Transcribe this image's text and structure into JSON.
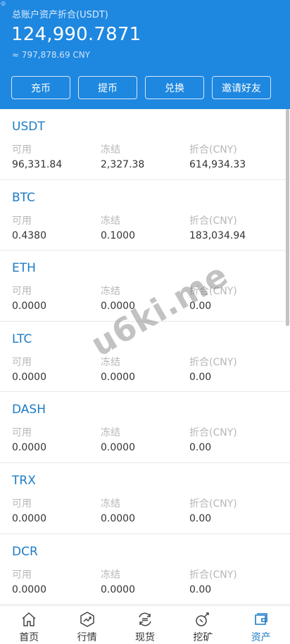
{
  "header": {
    "total_label": "总账户资产折合(USDT)",
    "total_value": "124,990.7871",
    "cny_value": "≈ 797,878.69 CNY",
    "buttons": [
      "充币",
      "提币",
      "兑换",
      "邀请好友"
    ]
  },
  "columns": [
    "可用",
    "冻结",
    "折合(CNY)"
  ],
  "coins": [
    {
      "name": "USDT",
      "available": "96,331.84",
      "frozen": "2,327.38",
      "cny": "614,934.33"
    },
    {
      "name": "BTC",
      "available": "0.4380",
      "frozen": "0.1000",
      "cny": "183,034.94"
    },
    {
      "name": "ETH",
      "available": "0.0000",
      "frozen": "0.0000",
      "cny": "0.00"
    },
    {
      "name": "LTC",
      "available": "0.0000",
      "frozen": "0.0000",
      "cny": "0.00"
    },
    {
      "name": "DASH",
      "available": "0.0000",
      "frozen": "0.0000",
      "cny": "0.00"
    },
    {
      "name": "TRX",
      "available": "0.0000",
      "frozen": "0.0000",
      "cny": "0.00"
    },
    {
      "name": "DCR",
      "available": "0.0000",
      "frozen": "0.0000",
      "cny": "0.00"
    }
  ],
  "watermark": "u6ki.me",
  "tabs": [
    {
      "label": "首页",
      "icon": "home-icon"
    },
    {
      "label": "行情",
      "icon": "market-chart-icon"
    },
    {
      "label": "现货",
      "icon": "exchange-icon"
    },
    {
      "label": "挖矿",
      "icon": "mining-icon"
    },
    {
      "label": "资产",
      "icon": "wallet-icon"
    }
  ],
  "colors": {
    "header_bg": "#1e87e0",
    "coin_name": "#1c7bc6",
    "active_tab": "#1c7bc6"
  }
}
